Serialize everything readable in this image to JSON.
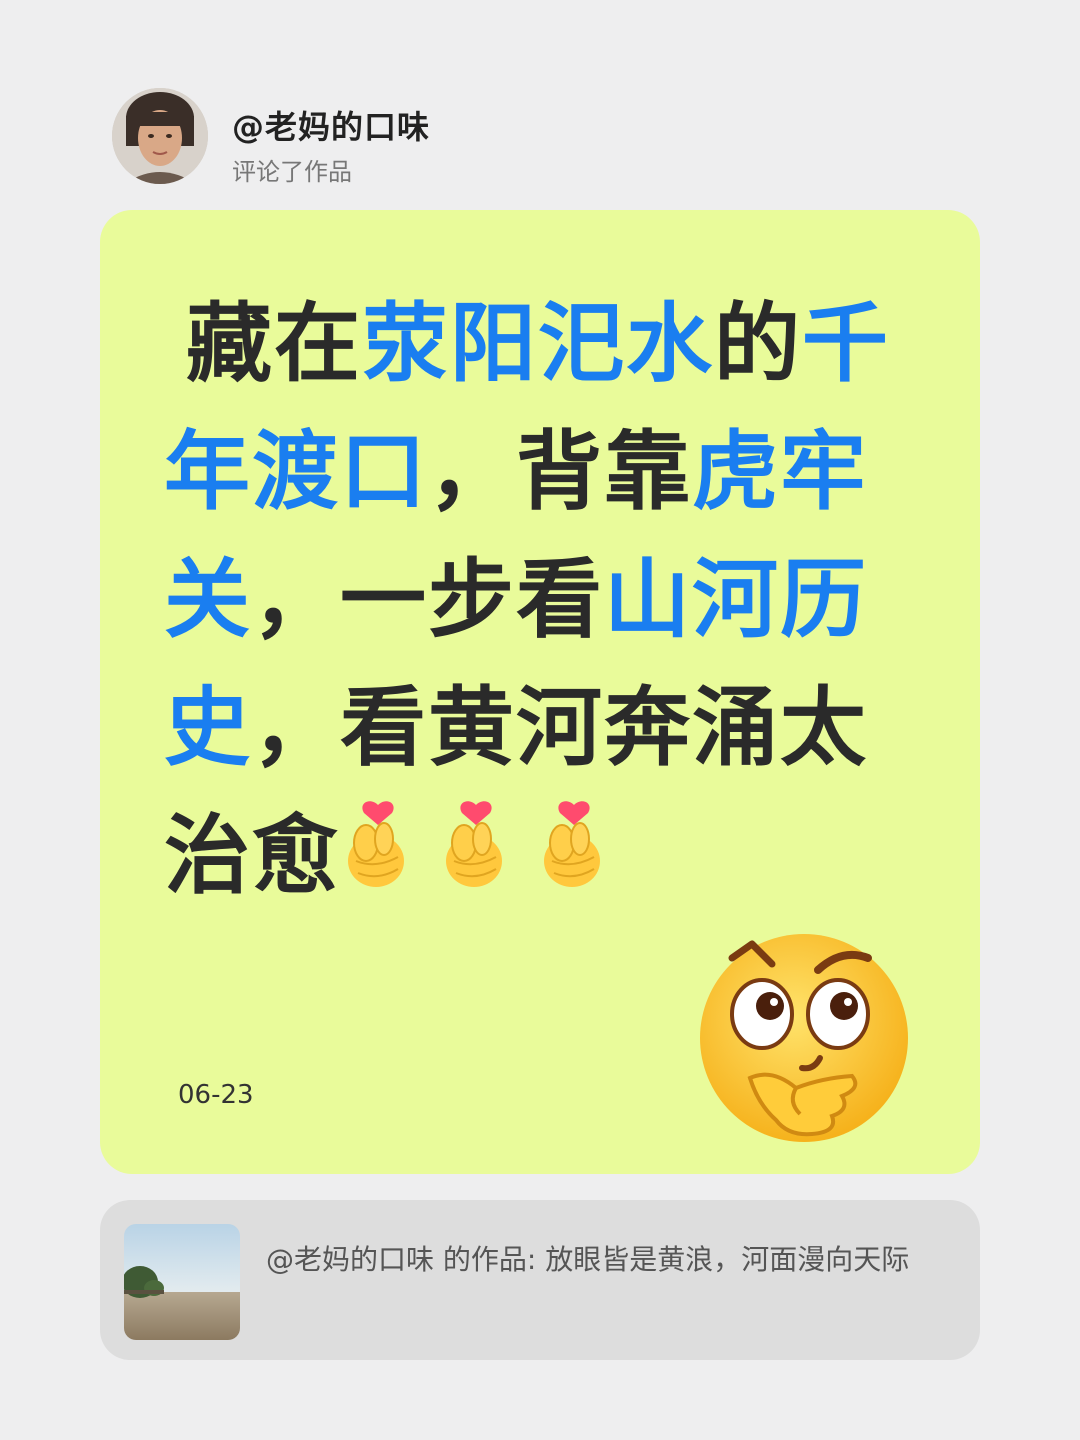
{
  "header": {
    "username": "@老妈的口味",
    "action": "评论了作品"
  },
  "comment": {
    "line1_a": "藏在",
    "line1_b": "荥阳汜水",
    "line1_c": "的",
    "line1_d": "千",
    "line2_a": "年渡口",
    "line2_b": "，背靠",
    "line2_c": "虎牢",
    "line3_a": "关",
    "line3_b": "，一步看",
    "line3_c": "山河历",
    "line4_a": "史",
    "line4_b": "，看黄河奔涌太",
    "line5_a": "治愈",
    "emoji_after": "finger-heart-icon",
    "emoji_count": 3,
    "date": "06-23"
  },
  "source": {
    "text": "@老妈的口味 的作品: 放眼皆是黄浪，河面漫向天际"
  },
  "colors": {
    "background": "#eeeeef",
    "card": "#e9fb9a",
    "highlight": "#1a7ef0",
    "text": "#2a2a2a",
    "source_bg": "#dddddd"
  }
}
